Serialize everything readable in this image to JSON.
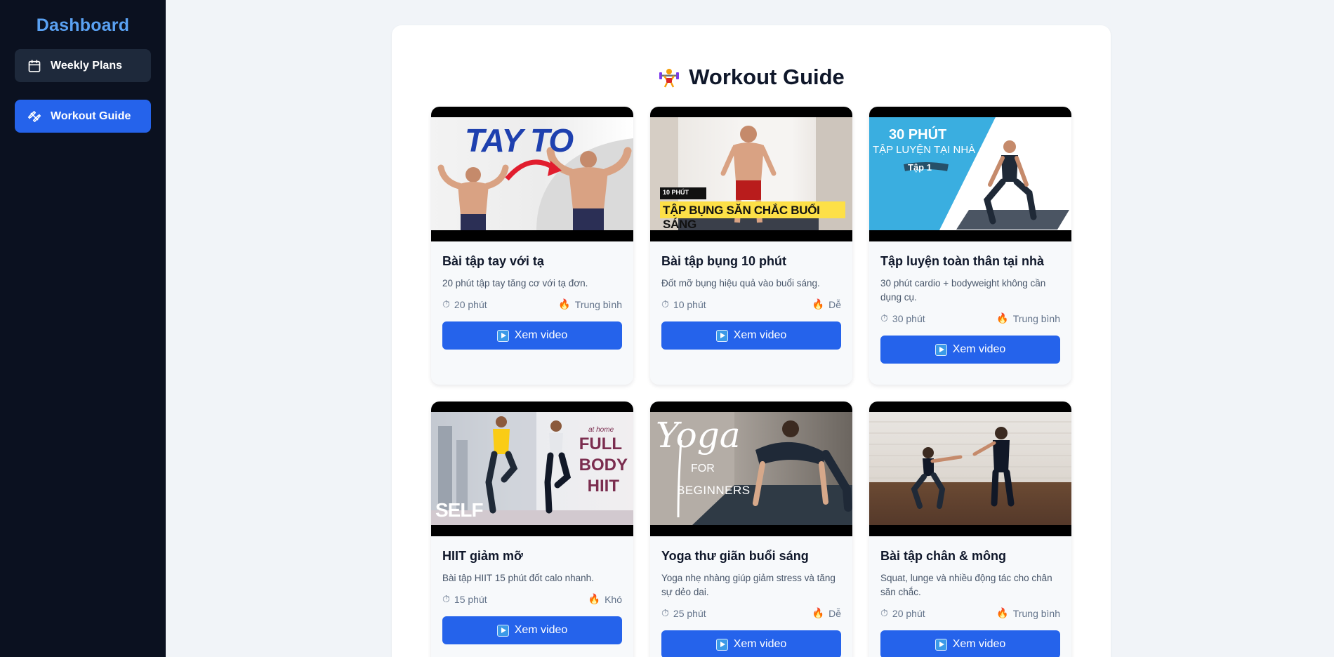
{
  "sidebar": {
    "brand": "Dashboard",
    "items": [
      {
        "label": "Weekly Plans",
        "icon": "calendar-icon",
        "active": false
      },
      {
        "label": "Workout Guide",
        "icon": "dumbbell-icon",
        "active": true
      }
    ]
  },
  "page": {
    "title": "Workout Guide",
    "title_icon": "weightlifter-emoji"
  },
  "cards": [
    {
      "title": "Bài tập tay với tạ",
      "desc": "20 phút tập tay tăng cơ với tạ đơn.",
      "duration": "20 phút",
      "level": "Trung bình",
      "button": "Xem video",
      "thumb": {
        "overlay": "TAY TO"
      }
    },
    {
      "title": "Bài tập bụng 10 phút",
      "desc": "Đốt mỡ bụng hiệu quả vào buổi sáng.",
      "duration": "10 phút",
      "level": "Dễ",
      "button": "Xem video",
      "thumb": {
        "tag": "10 PHÚT",
        "overlay": "TẬP BỤNG SĂN CHẮC BUỔI SÁNG"
      }
    },
    {
      "title": "Tập luyện toàn thân tại nhà",
      "desc": "30 phút cardio + bodyweight không cần dụng cụ.",
      "duration": "30 phút",
      "level": "Trung bình",
      "button": "Xem video",
      "thumb": {
        "line1": "30 PHÚT",
        "line2": "TẬP LUYỆN TẠI NHÀ",
        "line3": "Tập 1"
      }
    },
    {
      "title": "HIIT giảm mỡ",
      "desc": "Bài tập HIIT 15 phút đốt calo nhanh.",
      "duration": "15 phút",
      "level": "Khó",
      "button": "Xem video",
      "thumb": {
        "small": "at home",
        "line1": "FULL",
        "line2": "BODY",
        "line3": "HIIT",
        "logo": "SELF"
      }
    },
    {
      "title": "Yoga thư giãn buổi sáng",
      "desc": "Yoga nhẹ nhàng giúp giảm stress và tăng sự dẻo dai.",
      "duration": "25 phút",
      "level": "Dễ",
      "button": "Xem video",
      "thumb": {
        "line1": "Yoga",
        "line2": "FOR",
        "line3": "BEGINNERS"
      }
    },
    {
      "title": "Bài tập chân & mông",
      "desc": "Squat, lunge và nhiều động tác cho chân săn chắc.",
      "duration": "20 phút",
      "level": "Trung bình",
      "button": "Xem video",
      "thumb": {}
    }
  ],
  "colors": {
    "sidebar_bg": "#0b1120",
    "brand": "#5aa1f2",
    "accent": "#2563eb",
    "page_bg": "#f1f4f8"
  }
}
